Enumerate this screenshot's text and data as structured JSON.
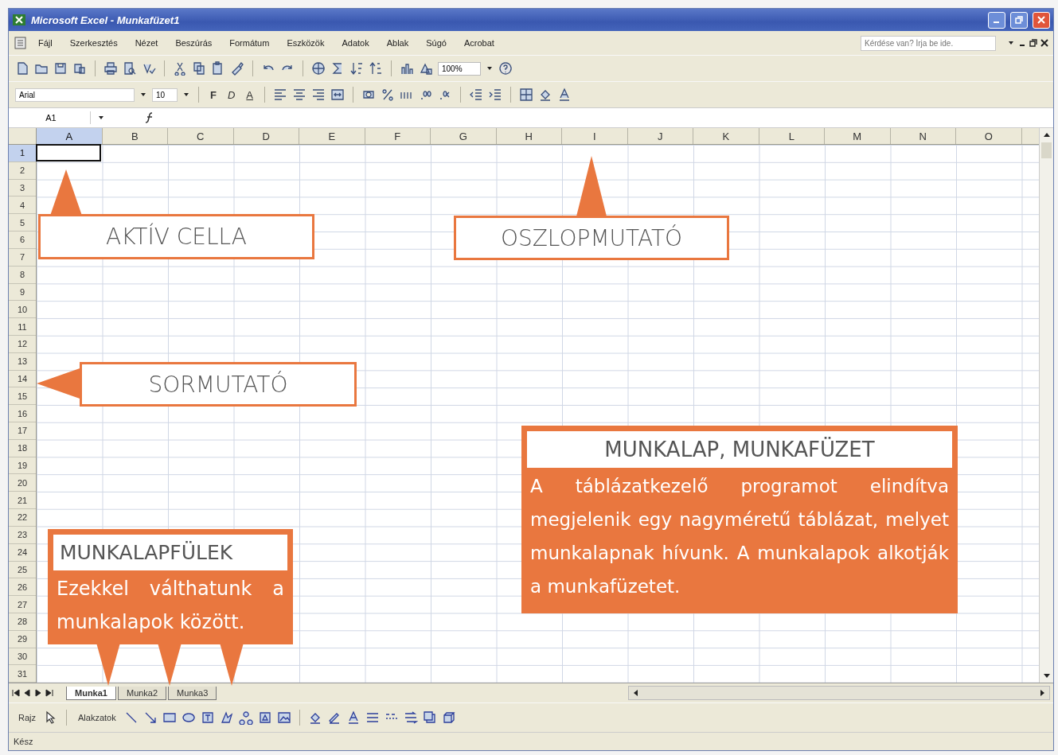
{
  "window": {
    "title": "Microsoft Excel - Munkafüzet1"
  },
  "menu": [
    "Fájl",
    "Szerkesztés",
    "Nézet",
    "Beszúrás",
    "Formátum",
    "Eszközök",
    "Adatok",
    "Ablak",
    "Súgó",
    "Acrobat"
  ],
  "help_box": {
    "placeholder": "Kérdése van? Írja be ide."
  },
  "standard_toolbar": {
    "zoom": "100%"
  },
  "formatting_toolbar": {
    "font": "Arial",
    "size": "10",
    "style_buttons": [
      "F",
      "D",
      "A"
    ]
  },
  "formula_bar": {
    "name_box": "A1"
  },
  "columns": [
    {
      "label": "A",
      "selected": true
    },
    {
      "label": "B",
      "selected": false
    },
    {
      "label": "C",
      "selected": false
    },
    {
      "label": "D",
      "selected": false
    },
    {
      "label": "E",
      "selected": false
    },
    {
      "label": "F",
      "selected": false
    },
    {
      "label": "G",
      "selected": false
    },
    {
      "label": "H",
      "selected": false
    },
    {
      "label": "I",
      "selected": false
    },
    {
      "label": "J",
      "selected": false
    },
    {
      "label": "K",
      "selected": false
    },
    {
      "label": "L",
      "selected": false
    },
    {
      "label": "M",
      "selected": false
    },
    {
      "label": "N",
      "selected": false
    },
    {
      "label": "O",
      "selected": false
    }
  ],
  "rows": [
    {
      "label": "1",
      "selected": true
    },
    {
      "label": "2",
      "selected": false
    },
    {
      "label": "3",
      "selected": false
    },
    {
      "label": "4",
      "selected": false
    },
    {
      "label": "5",
      "selected": false
    },
    {
      "label": "6",
      "selected": false
    },
    {
      "label": "7",
      "selected": false
    },
    {
      "label": "8",
      "selected": false
    },
    {
      "label": "9",
      "selected": false
    },
    {
      "label": "10",
      "selected": false
    },
    {
      "label": "11",
      "selected": false
    },
    {
      "label": "12",
      "selected": false
    },
    {
      "label": "13",
      "selected": false
    },
    {
      "label": "14",
      "selected": false
    },
    {
      "label": "15",
      "selected": false
    },
    {
      "label": "16",
      "selected": false
    },
    {
      "label": "17",
      "selected": false
    },
    {
      "label": "18",
      "selected": false
    },
    {
      "label": "19",
      "selected": false
    },
    {
      "label": "20",
      "selected": false
    },
    {
      "label": "21",
      "selected": false
    },
    {
      "label": "22",
      "selected": false
    },
    {
      "label": "23",
      "selected": false
    },
    {
      "label": "24",
      "selected": false
    },
    {
      "label": "25",
      "selected": false
    },
    {
      "label": "26",
      "selected": false
    },
    {
      "label": "27",
      "selected": false
    },
    {
      "label": "28",
      "selected": false
    },
    {
      "label": "29",
      "selected": false
    },
    {
      "label": "30",
      "selected": false
    },
    {
      "label": "31",
      "selected": false
    }
  ],
  "sheet_tabs": [
    {
      "label": "Munka1",
      "selected": true
    },
    {
      "label": "Munka2",
      "selected": false
    },
    {
      "label": "Munka3",
      "selected": false
    }
  ],
  "drawing_toolbar": {
    "draw_menu": "Rajz",
    "shapes_menu": "Alakzatok"
  },
  "status_bar": "Kész",
  "callouts": [
    {
      "kind": "label",
      "title": "AKTÍV CELLA"
    },
    {
      "kind": "label",
      "title": "OSZLOPMUTATÓ"
    },
    {
      "kind": "label",
      "title": "SORMUTATÓ"
    },
    {
      "kind": "note",
      "title": "MUNKALAPFÜLEK",
      "body": "Ezekkel válthatunk a munkalapok között."
    },
    {
      "kind": "note",
      "title": "MUNKALAP, MUNKAFÜZET",
      "body": "A táblázatkezelő programot elindítva megjelenik egy nagyméretű táblázat, melyet munkalapnak hívunk. A munkalapok alkotják a munkafüzetet."
    }
  ]
}
